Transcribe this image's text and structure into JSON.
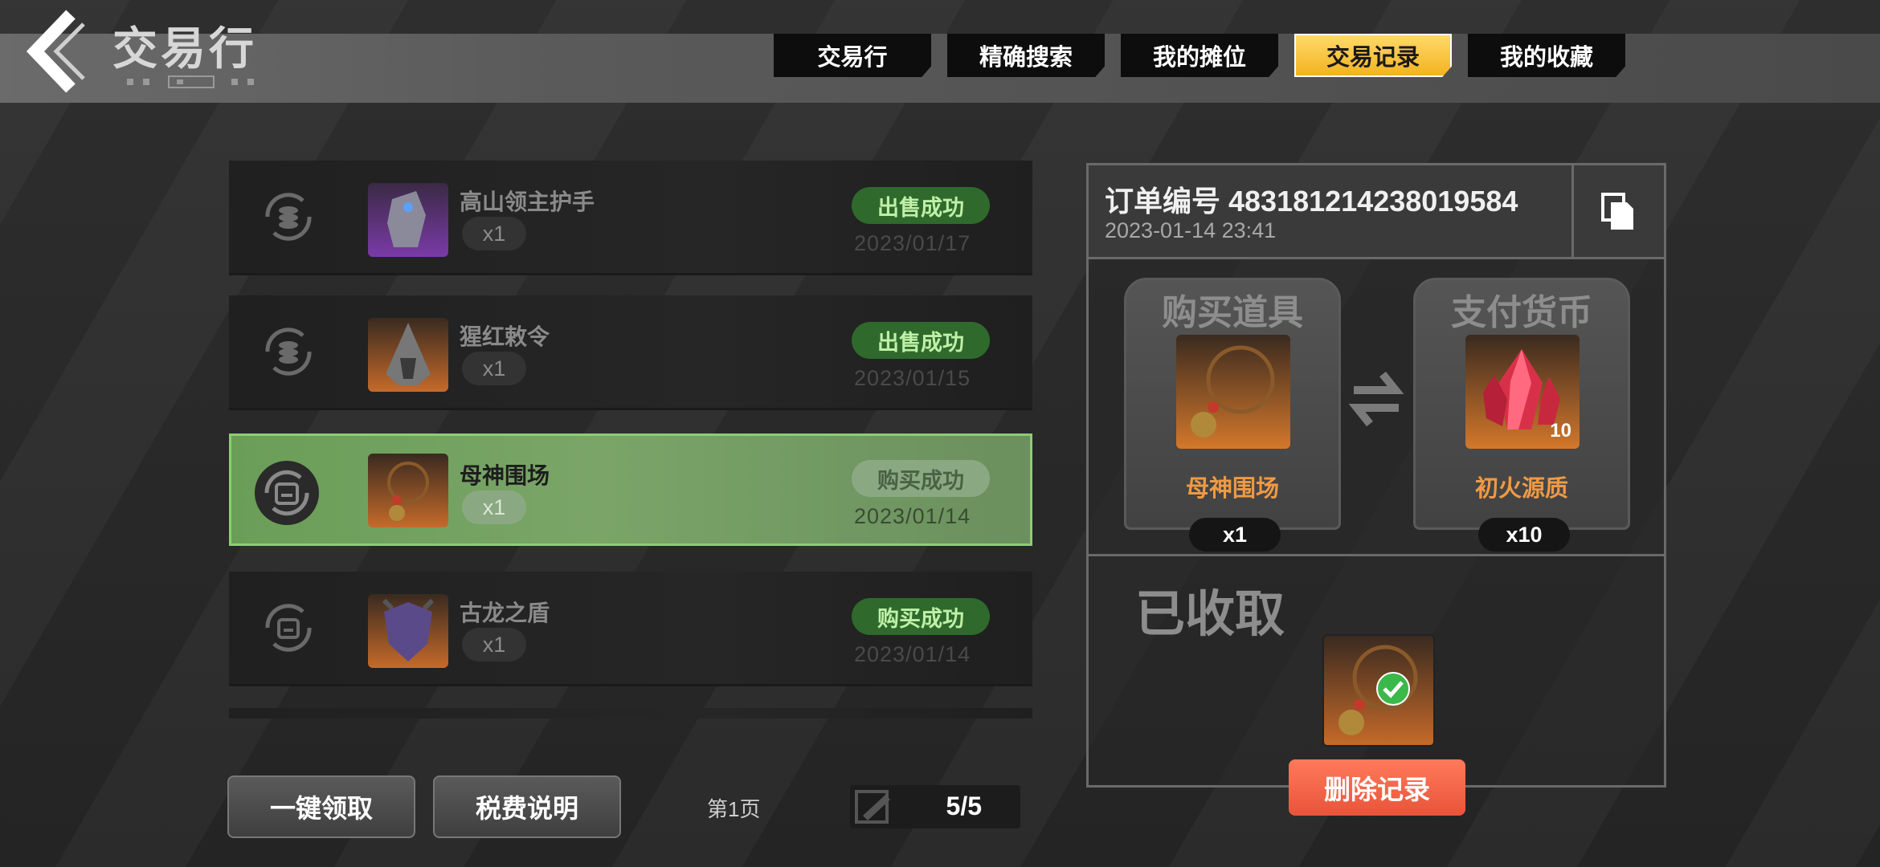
{
  "header": {
    "title": "交易行"
  },
  "tabs": [
    {
      "label": "交易行",
      "active": false
    },
    {
      "label": "精确搜索",
      "active": false
    },
    {
      "label": "我的摊位",
      "active": false
    },
    {
      "label": "交易记录",
      "active": true
    },
    {
      "label": "我的收藏",
      "active": false
    }
  ],
  "records": [
    {
      "name": "高山领主护手",
      "qty": "x1",
      "status": "出售成功",
      "date": "2023/01/17",
      "icon": "coin-swap-icon",
      "thumb": "purple"
    },
    {
      "name": "猩红敕令",
      "qty": "x1",
      "status": "出售成功",
      "date": "2023/01/15",
      "icon": "coin-swap-icon",
      "thumb": "orange"
    },
    {
      "name": "母神围场",
      "qty": "x1",
      "status": "购买成功",
      "date": "2023/01/14",
      "icon": "bag-swap-icon",
      "thumb": "orange",
      "selected": true
    },
    {
      "name": "古龙之盾",
      "qty": "x1",
      "status": "购买成功",
      "date": "2023/01/14",
      "icon": "bag-swap-icon",
      "thumb": "orange"
    }
  ],
  "bottom": {
    "claim_all": "一键领取",
    "tax_info": "税费说明",
    "page_label": "第1页",
    "pager": "5/5"
  },
  "detail": {
    "order_no": "订单编号 483181214238019584",
    "order_time": "2023-01-14 23:41",
    "buy_title": "购买道具",
    "pay_title": "支付货币",
    "buy_item_name": "母神围场",
    "buy_item_qty": "x1",
    "pay_item_name": "初火源质",
    "pay_item_qty": "x10",
    "pay_badge": "10",
    "received": "已收取",
    "delete": "删除记录"
  },
  "colors": {
    "accent": "#f3b320",
    "success": "#2f6a2c",
    "danger": "#e8543a",
    "item_name": "#ef9a44"
  }
}
